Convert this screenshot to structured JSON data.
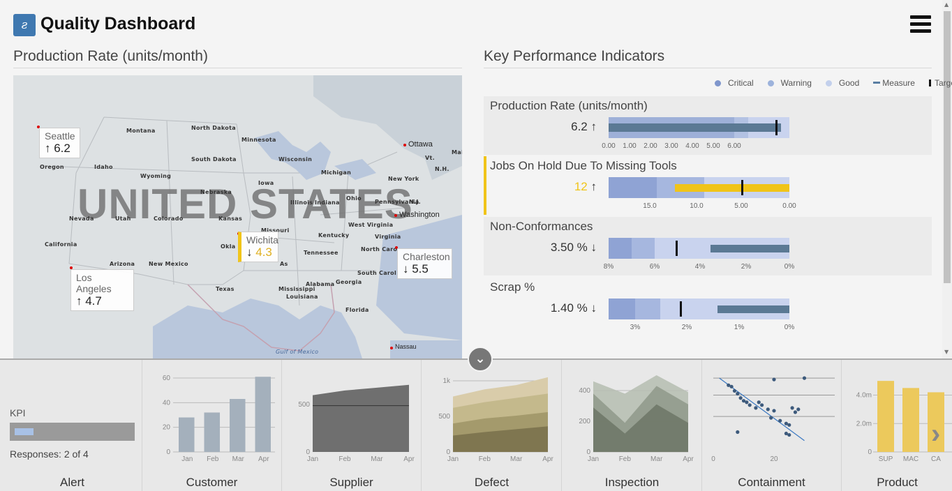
{
  "header": {
    "logo_text": "ƨ",
    "title": "Quality Dashboard"
  },
  "left": {
    "title": "Production Rate (units/month)"
  },
  "map": {
    "country": "UNITED STATES",
    "states": [
      {
        "label": "Montana"
      },
      {
        "label": "North Dakota"
      },
      {
        "label": "Minnesota"
      },
      {
        "label": "Oregon"
      },
      {
        "label": "Idaho"
      },
      {
        "label": "South Dakota"
      },
      {
        "label": "Wisconsin"
      },
      {
        "label": "Michigan"
      },
      {
        "label": "Wyoming"
      },
      {
        "label": "Iowa"
      },
      {
        "label": "New York"
      },
      {
        "label": "Nebraska"
      },
      {
        "label": "Illinois"
      },
      {
        "label": "Indiana"
      },
      {
        "label": "Ohio"
      },
      {
        "label": "Pennsylvania"
      },
      {
        "label": "N.J."
      },
      {
        "label": "Nevada"
      },
      {
        "label": "Utah"
      },
      {
        "label": "Colorado"
      },
      {
        "label": "Kansas"
      },
      {
        "label": "Missouri"
      },
      {
        "label": "West Virginia"
      },
      {
        "label": "Kentucky"
      },
      {
        "label": "Virginia"
      },
      {
        "label": "California"
      },
      {
        "label": "Okla"
      },
      {
        "label": "Tennessee"
      },
      {
        "label": "North Caro"
      },
      {
        "label": "Arizona"
      },
      {
        "label": "New Mexico"
      },
      {
        "label": "As"
      },
      {
        "label": "South Carol"
      },
      {
        "label": "Alabama"
      },
      {
        "label": "Georgia"
      },
      {
        "label": "Texas"
      },
      {
        "label": "Mississippi"
      },
      {
        "label": "Louisiana"
      },
      {
        "label": "Florida"
      },
      {
        "label": "Gulf of Mexico"
      },
      {
        "label": "Vt."
      },
      {
        "label": "N.H."
      },
      {
        "label": "Mai"
      }
    ],
    "cities": [
      {
        "label": "Ottawa"
      },
      {
        "label": "Washington"
      },
      {
        "label": "Nassau"
      }
    ],
    "cards": [
      {
        "name": "Seattle",
        "value": "↑ 6.2"
      },
      {
        "name": "Los Angeles",
        "value": "↑ 4.7"
      },
      {
        "name": "Wichita",
        "arrow": "↓",
        "value": "4.3"
      },
      {
        "name": "Charleston",
        "value": "↓ 5.5"
      }
    ]
  },
  "right": {
    "title": "Key Performance Indicators"
  },
  "legend": {
    "items": [
      {
        "label": "Critical",
        "color": "#7f96cc"
      },
      {
        "label": "Warning",
        "color": "#9db3dc"
      },
      {
        "label": "Good",
        "color": "#c3d0ec"
      },
      {
        "label": "Measure",
        "color": "#5a7fa3"
      },
      {
        "label": "Target",
        "color": "#111111"
      }
    ]
  },
  "kpis": [
    {
      "title": "Production Rate (units/month)",
      "value": "6.2",
      "arrow": "↑",
      "ticks": [
        "0.00",
        "1.00",
        "2.00",
        "3.00",
        "4.00",
        "5.00",
        "6.00"
      ]
    },
    {
      "title": "Jobs On Hold Due To Missing Tools",
      "value": "12",
      "arrow": "↑",
      "ticks": [
        "15.0",
        "10.0",
        "5.00",
        "0.00"
      ]
    },
    {
      "title": "Non-Conformances",
      "value": "3.50 %",
      "arrow": "↓",
      "ticks": [
        "8%",
        "6%",
        "4%",
        "2%",
        "0%"
      ]
    },
    {
      "title": "Scrap %",
      "value": "1.40 %",
      "arrow": "↓",
      "ticks": [
        "3%",
        "2%",
        "1%",
        "0%"
      ]
    }
  ],
  "tiles": {
    "alert": {
      "kpi_label": "KPI",
      "responses": "Responses: 2 of 4",
      "caption": "Alert"
    },
    "customer": {
      "caption": "Customer"
    },
    "supplier": {
      "caption": "Supplier"
    },
    "defect": {
      "caption": "Defect"
    },
    "inspection": {
      "caption": "Inspection"
    },
    "containment": {
      "caption": "Containment"
    },
    "product": {
      "caption": "Product"
    }
  },
  "chart_data": [
    {
      "type": "bar",
      "title": "Customer",
      "categories": [
        "Jan",
        "Feb",
        "Mar",
        "Apr"
      ],
      "values": [
        28,
        32,
        43,
        61
      ],
      "ylim": [
        0,
        60
      ],
      "yticks": [
        "0",
        "20",
        "40",
        "60"
      ]
    },
    {
      "type": "area",
      "title": "Supplier",
      "categories": [
        "Jan",
        "Feb",
        "Mar",
        "Apr"
      ],
      "values": [
        600,
        650,
        680,
        710
      ],
      "line": 490,
      "yticks": [
        "0",
        "500"
      ]
    },
    {
      "type": "area",
      "title": "Defect",
      "categories": [
        "Jan",
        "Feb",
        "Mar",
        "Apr"
      ],
      "series": [
        {
          "values": [
            230,
            280,
            320,
            360
          ]
        },
        {
          "values": [
            400,
            470,
            510,
            560
          ]
        },
        {
          "values": [
            620,
            700,
            760,
            820
          ]
        },
        {
          "values": [
            780,
            880,
            940,
            1050
          ]
        }
      ],
      "yticks": [
        "0",
        "500",
        "1k"
      ]
    },
    {
      "type": "area",
      "title": "Inspection",
      "categories": [
        "Jan",
        "Feb",
        "Mar",
        "Apr"
      ],
      "series": [
        {
          "values": [
            290,
            120,
            310,
            190
          ]
        },
        {
          "values": [
            380,
            190,
            430,
            310
          ]
        },
        {
          "values": [
            460,
            380,
            500,
            390
          ]
        }
      ],
      "yticks": [
        "0",
        "200",
        "400"
      ]
    },
    {
      "type": "scatter",
      "title": "Containment",
      "xticks": [
        "0",
        "20"
      ],
      "points": [
        [
          5,
          47
        ],
        [
          6,
          46
        ],
        [
          7,
          43
        ],
        [
          8,
          41
        ],
        [
          9,
          38
        ],
        [
          10,
          36
        ],
        [
          11,
          35
        ],
        [
          12,
          33
        ],
        [
          14,
          31
        ],
        [
          15,
          35
        ],
        [
          16,
          33
        ],
        [
          18,
          30
        ],
        [
          19,
          24
        ],
        [
          20,
          29
        ],
        [
          22,
          22
        ],
        [
          24,
          20
        ],
        [
          25,
          19
        ],
        [
          26,
          31
        ],
        [
          27,
          28
        ],
        [
          28,
          30
        ],
        [
          20,
          51
        ],
        [
          30,
          52
        ],
        [
          8,
          14
        ],
        [
          24,
          13
        ],
        [
          25,
          12
        ]
      ]
    },
    {
      "type": "bar",
      "title": "Product",
      "categories": [
        "SUP",
        "MAC",
        "CA"
      ],
      "values": [
        5.0,
        4.5,
        4.2
      ],
      "yticks": [
        "0",
        "2.0m",
        "4.0m"
      ]
    }
  ],
  "colors": {
    "tile_bar": "#a4b0bc",
    "supplier": "#6f6f6f",
    "defect": [
      "#7f7650",
      "#a49a6c",
      "#c4b98c",
      "#d9ccaa"
    ],
    "inspection": [
      "#6d7566",
      "#8f998a",
      "#b5bdb0"
    ],
    "product": "#ecc95c",
    "warning": "#f0c419"
  }
}
